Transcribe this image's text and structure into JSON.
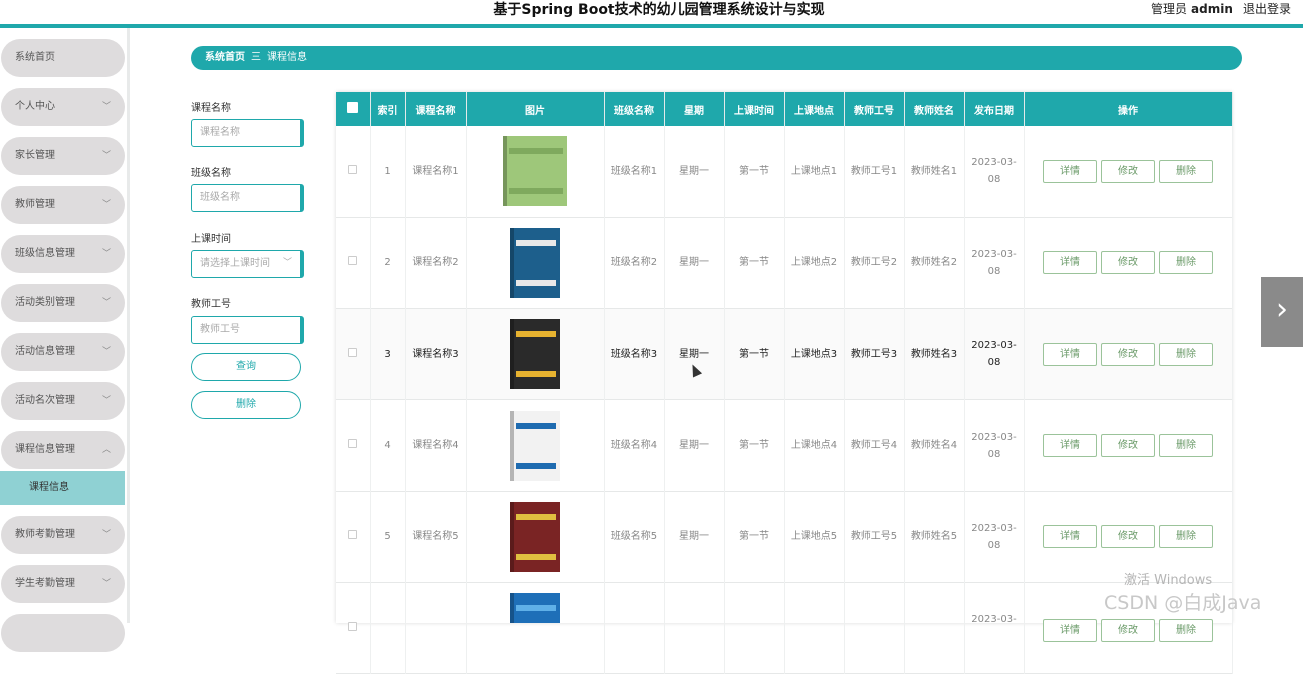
{
  "header": {
    "title": "基于Spring Boot技术的幼儿园管理系统设计与实现",
    "user_role": "管理员",
    "user_name": "admin",
    "logout": "退出登录",
    "accent_color": "#1fa8ab"
  },
  "sidebar": {
    "items": [
      {
        "label": "系统首页",
        "chevron": ""
      },
      {
        "label": "个人中心",
        "chevron": "﹀"
      },
      {
        "label": "家长管理",
        "chevron": "﹀"
      },
      {
        "label": "教师管理",
        "chevron": "﹀"
      },
      {
        "label": "班级信息管理",
        "chevron": "﹀"
      },
      {
        "label": "活动类别管理",
        "chevron": "﹀"
      },
      {
        "label": "活动信息管理",
        "chevron": "﹀"
      },
      {
        "label": "活动名次管理",
        "chevron": "﹀"
      },
      {
        "label": "课程信息管理",
        "chevron": "︿"
      },
      {
        "label": "教师考勤管理",
        "chevron": "﹀"
      },
      {
        "label": "学生考勤管理",
        "chevron": "﹀"
      }
    ],
    "active_sub": "课程信息"
  },
  "breadcrumb": {
    "home": "系统首页",
    "separator": "三",
    "current": "课程信息"
  },
  "search": {
    "course_name_label": "课程名称",
    "course_name_placeholder": "课程名称",
    "class_name_label": "班级名称",
    "class_name_placeholder": "班级名称",
    "time_label": "上课时间",
    "time_placeholder": "请选择上课时间",
    "teacher_id_label": "教师工号",
    "teacher_id_placeholder": "教师工号",
    "query_button": "查询",
    "delete_button": "删除"
  },
  "table": {
    "columns": [
      "索引",
      "课程名称",
      "图片",
      "班级名称",
      "星期",
      "上课时间",
      "上课地点",
      "教师工号",
      "教师姓名",
      "发布日期",
      "操作"
    ],
    "actions": {
      "detail": "详情",
      "edit": "修改",
      "delete": "删除"
    },
    "rows": [
      {
        "index": "1",
        "course": "课程名称1",
        "class": "班级名称1",
        "weekday": "星期一",
        "time": "第一节",
        "place": "上课地点1",
        "teacher_id": "教师工号1",
        "teacher_name": "教师姓名1",
        "date_line1": "2023-03-",
        "date_line2": "08"
      },
      {
        "index": "2",
        "course": "课程名称2",
        "class": "班级名称2",
        "weekday": "星期一",
        "time": "第一节",
        "place": "上课地点2",
        "teacher_id": "教师工号2",
        "teacher_name": "教师姓名2",
        "date_line1": "2023-03-",
        "date_line2": "08"
      },
      {
        "index": "3",
        "course": "课程名称3",
        "class": "班级名称3",
        "weekday": "星期一",
        "time": "第一节",
        "place": "上课地点3",
        "teacher_id": "教师工号3",
        "teacher_name": "教师姓名3",
        "date_line1": "2023-03-",
        "date_line2": "08"
      },
      {
        "index": "4",
        "course": "课程名称4",
        "class": "班级名称4",
        "weekday": "星期一",
        "time": "第一节",
        "place": "上课地点4",
        "teacher_id": "教师工号4",
        "teacher_name": "教师姓名4",
        "date_line1": "2023-03-",
        "date_line2": "08"
      },
      {
        "index": "5",
        "course": "课程名称5",
        "class": "班级名称5",
        "weekday": "星期一",
        "time": "第一节",
        "place": "上课地点5",
        "teacher_id": "教师工号5",
        "teacher_name": "教师姓名5",
        "date_line1": "2023-03-",
        "date_line2": "08"
      },
      {
        "index": "",
        "course": "",
        "class": "",
        "weekday": "",
        "time": "",
        "place": "",
        "teacher_id": "",
        "teacher_name": "",
        "date_line1": "2023-03-",
        "date_line2": ""
      }
    ],
    "book_colors": [
      {
        "cover": "#9ec77a",
        "band": "#7fa95e"
      },
      {
        "cover": "#1d5f8c",
        "band": "#e8e8e8"
      },
      {
        "cover": "#2a2a2a",
        "band": "#e6b230"
      },
      {
        "cover": "#f2f2f2",
        "band": "#1e6bb0"
      },
      {
        "cover": "#7a2424",
        "band": "#e0c040"
      },
      {
        "cover": "#1e6fb8",
        "band": "#5fb0e8"
      }
    ]
  },
  "watermark": {
    "line1": "激活 Windows",
    "line2": "CSDN @白成Java"
  }
}
